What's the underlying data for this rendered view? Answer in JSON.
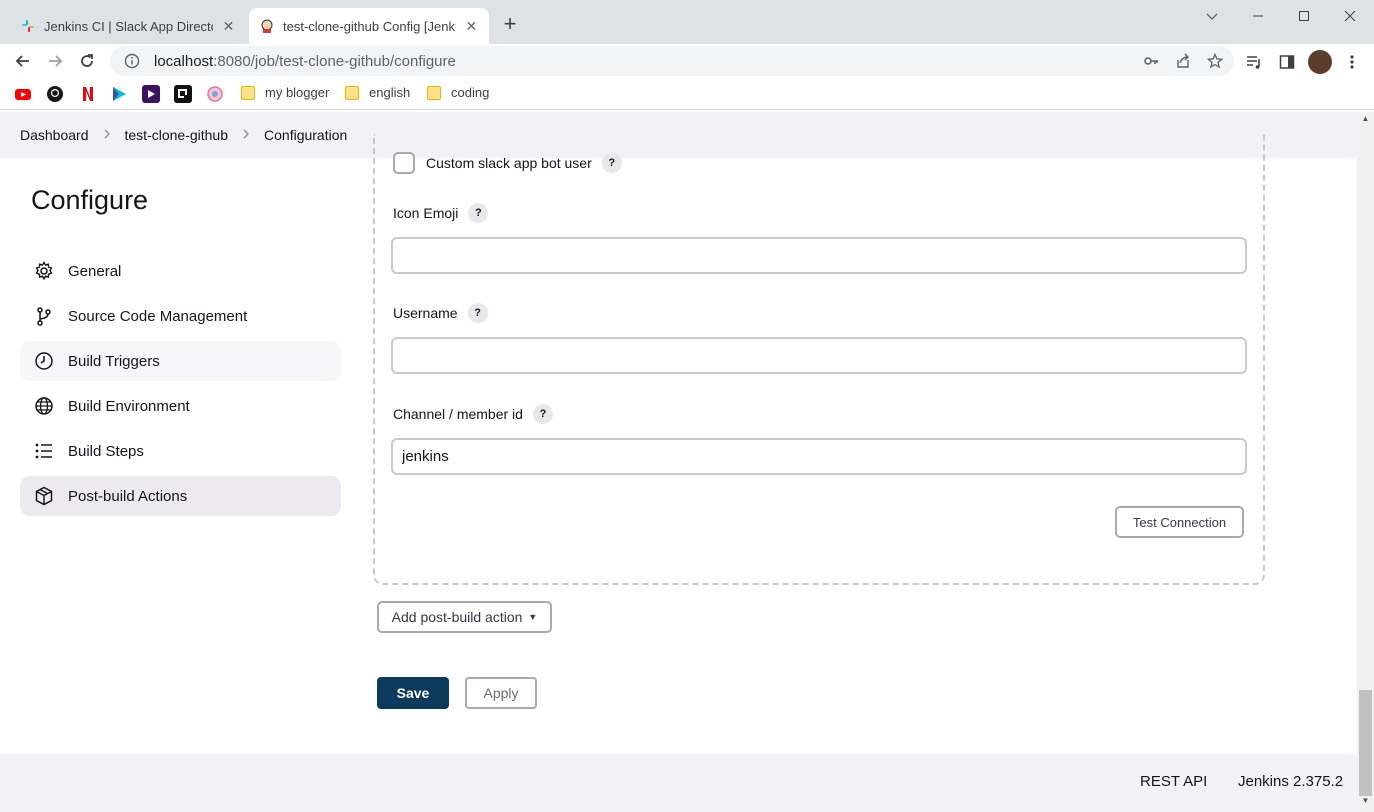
{
  "browser": {
    "tabs": [
      {
        "title": "Jenkins CI | Slack App Directory",
        "active": false,
        "close": "✕"
      },
      {
        "title": "test-clone-github Config [Jenkins]",
        "active": true,
        "close": "✕"
      }
    ],
    "new_tab": "+",
    "window_controls": {
      "minimize": "—",
      "maximize": "☐",
      "close": "✕"
    },
    "url_host": "localhost",
    "url_path": ":8080/job/test-clone-github/configure",
    "bookmarks": [
      {
        "icon": "youtube-icon",
        "color": "#ff0000"
      },
      {
        "icon": "github-icon",
        "color": "#181717"
      },
      {
        "icon": "netflix-icon",
        "color": "#e50914"
      },
      {
        "icon": "play-icon",
        "color": "#00c4cc"
      },
      {
        "icon": "video-icon",
        "color": "#3c1361"
      },
      {
        "icon": "app-icon",
        "color": "#111111"
      },
      {
        "icon": "globe-app-icon",
        "color": "#e57399"
      }
    ],
    "bookmark_folders": [
      "my blogger",
      "english",
      "coding"
    ]
  },
  "breadcrumbs": [
    "Dashboard",
    "test-clone-github",
    "Configuration"
  ],
  "sidebar": {
    "heading": "Configure",
    "items": [
      {
        "label": "General",
        "icon": "gear-icon"
      },
      {
        "label": "Source Code Management",
        "icon": "branch-icon"
      },
      {
        "label": "Build Triggers",
        "icon": "timer-icon"
      },
      {
        "label": "Build Environment",
        "icon": "globe-icon"
      },
      {
        "label": "Build Steps",
        "icon": "list-icon"
      },
      {
        "label": "Post-build Actions",
        "icon": "cube-icon"
      }
    ]
  },
  "form": {
    "custom_bot_label": "Custom slack app bot user",
    "icon_emoji_label": "Icon Emoji",
    "icon_emoji_value": "",
    "username_label": "Username",
    "username_value": "",
    "channel_label": "Channel / member id",
    "channel_value": "jenkins",
    "help": "?",
    "test_connection": "Test Connection",
    "add_post_build": "Add post-build action",
    "save": "Save",
    "apply": "Apply"
  },
  "footer": {
    "rest_api": "REST API",
    "version": "Jenkins 2.375.2"
  },
  "colors": {
    "save_button": "#0b3a5d",
    "page_bg": "#ffffff",
    "breadcrumb_bg": "#f2f1f5"
  }
}
